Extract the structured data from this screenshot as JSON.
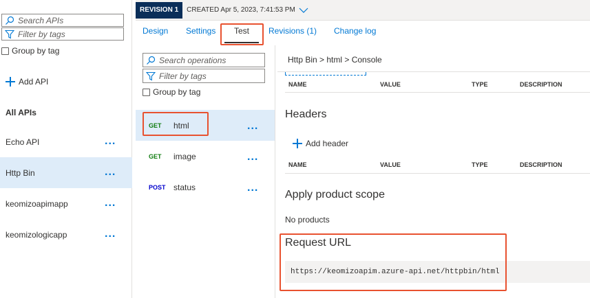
{
  "api_panel": {
    "search_placeholder": "Search APIs",
    "filter_placeholder": "Filter by tags",
    "group_by_tag": "Group by tag",
    "add_api": "Add API",
    "all_apis": "All APIs",
    "apis": [
      {
        "label": "Echo API",
        "selected": false
      },
      {
        "label": "Http Bin",
        "selected": true
      },
      {
        "label": "keomizoapimapp",
        "selected": false
      },
      {
        "label": "keomizologicapp",
        "selected": false
      }
    ],
    "more_glyph": "..."
  },
  "revision": {
    "badge": "REVISION 1",
    "created": "CREATED Apr 5, 2023, 7:41:53 PM"
  },
  "tabs": [
    "Design",
    "Settings",
    "Test",
    "Revisions (1)",
    "Change log"
  ],
  "active_tab": "Test",
  "operations_panel": {
    "search_placeholder": "Search operations",
    "filter_placeholder": "Filter by tags",
    "group_by_tag": "Group by tag",
    "operations": [
      {
        "method": "GET",
        "name": "html",
        "selected": true
      },
      {
        "method": "GET",
        "name": "image",
        "selected": false
      },
      {
        "method": "POST",
        "name": "status",
        "selected": false
      }
    ]
  },
  "console": {
    "breadcrumb": "Http Bin > html > Console",
    "params_columns": [
      "NAME",
      "VALUE",
      "TYPE",
      "DESCRIPTION"
    ],
    "headers_title": "Headers",
    "add_header": "Add header",
    "headers_columns": [
      "NAME",
      "VALUE",
      "TYPE",
      "DESCRIPTION"
    ],
    "product_scope_title": "Apply product scope",
    "no_products": "No products",
    "request_url_title": "Request URL",
    "request_url": "https://keomizoapim.azure-api.net/httpbin/html"
  },
  "colors": {
    "accent": "#0078d4",
    "selected_bg": "#deecf9",
    "revision_badge": "#0a2e59",
    "highlight": "#e8512f",
    "get": "#107c10",
    "post": "#0000cc"
  }
}
